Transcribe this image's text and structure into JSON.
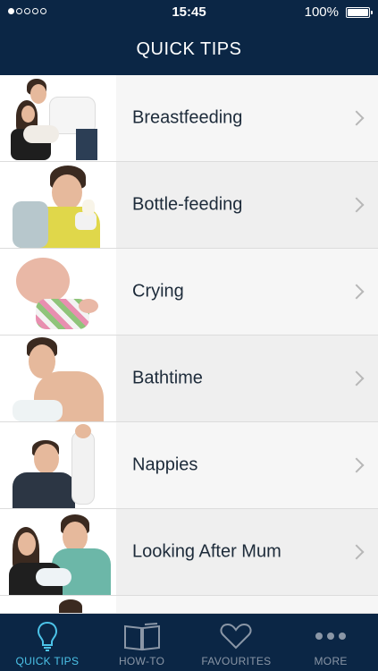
{
  "status_bar": {
    "time": "15:45",
    "battery": "100%"
  },
  "header": {
    "title": "QUICK TIPS"
  },
  "list": [
    {
      "label": "Breastfeeding"
    },
    {
      "label": "Bottle-feeding"
    },
    {
      "label": "Crying"
    },
    {
      "label": "Bathtime"
    },
    {
      "label": "Nappies"
    },
    {
      "label": "Looking After Mum"
    }
  ],
  "tabs": [
    {
      "label": "QUICK TIPS",
      "icon": "lightbulb-icon",
      "active": true
    },
    {
      "label": "HOW-TO",
      "icon": "book-icon",
      "active": false
    },
    {
      "label": "FAVOURITES",
      "icon": "heart-icon",
      "active": false
    },
    {
      "label": "MORE",
      "icon": "more-dots-icon",
      "active": false
    }
  ],
  "colors": {
    "header_bg": "#0b2645",
    "active_tab": "#4cc3e8",
    "inactive_tab": "#8a96a6"
  }
}
